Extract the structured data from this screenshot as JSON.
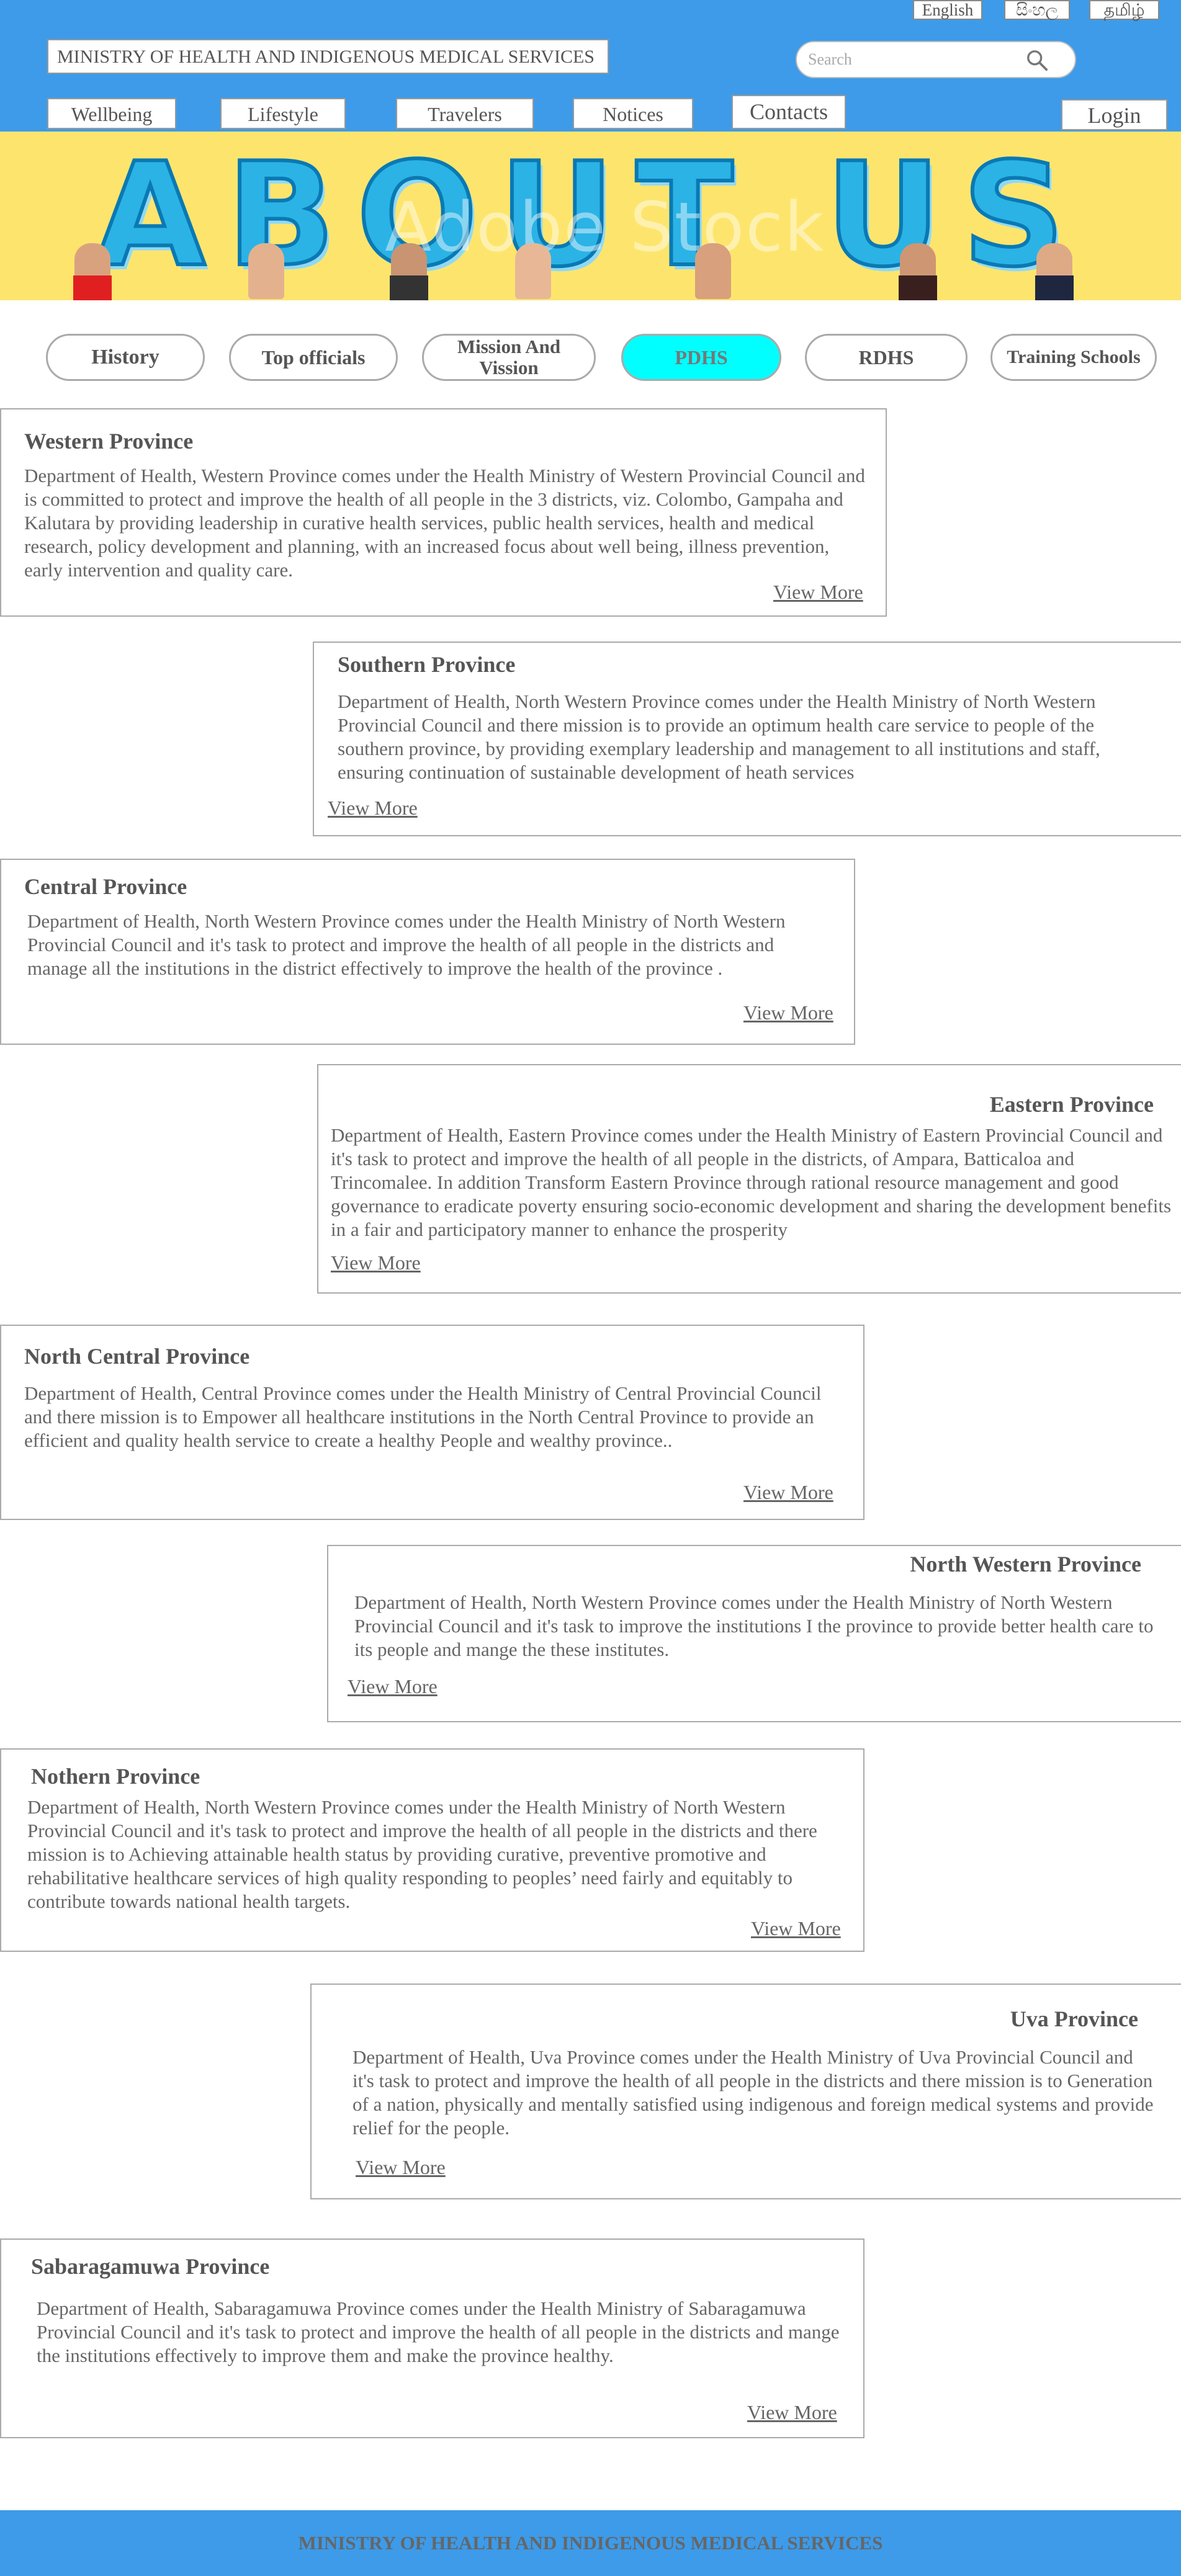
{
  "header": {
    "languages": [
      "English",
      "සිංහල",
      "தமிழ்"
    ],
    "ministry_title": "MINISTRY OF HEALTH AND INDIGENOUS MEDICAL SERVICES",
    "search_placeholder": "Search",
    "nav": [
      "Wellbeing",
      "Lifestyle",
      "Travelers",
      "Notices",
      "Contacts"
    ],
    "login": "Login",
    "colors": {
      "header_bg": "#3d9be9",
      "banner_bg": "#fde56d",
      "active_tab": "#00ffff"
    }
  },
  "banner": {
    "text": "ABOUT US",
    "watermark": "Adobe Stock"
  },
  "tabs": [
    "History",
    "Top officials",
    "Mission And Vission",
    "PDHS",
    "RDHS",
    "Training Schools"
  ],
  "active_tab": "PDHS",
  "provinces": [
    {
      "title": "Western Province",
      "body": "Department of Health, Western Province comes under the Health Ministry of Western Provincial Council and is committed to protect and improve the health of all people in the 3 districts, viz. Colombo, Gampaha and Kalutara by providing leadership in curative health services, public health services, health and medical research, policy development and planning, with an increased focus about well being, illness prevention, early intervention and quality care.",
      "link": "View More"
    },
    {
      "title": "Southern Province",
      "body": "Department of Health, North Western Province comes under the Health Ministry of North Western Provincial Council and there mission is to provide an optimum health care service to people of the southern province, by providing exemplary leadership and  management to all institutions and staff, ensuring continuation of sustainable development of heath services",
      "link": "View More"
    },
    {
      "title": "Central Province",
      "body": "Department of Health, North Western Province comes under the Health Ministry of North Western Provincial Council and it's task to protect and improve the health of all people in the districts and manage all the institutions in the district effectively to improve the health of the province .",
      "link": "View More"
    },
    {
      "title": "Eastern Province",
      "body": "Department of Health, Eastern Province comes under the Health Ministry of Eastern Provincial Council and it's task to protect and improve the health of all people in the districts, of Ampara, Batticaloa and Trincomalee. In addition Transform Eastern Province through rational resource management and good governance to eradicate poverty ensuring socio-economic development and sharing the development benefits in a fair and participatory manner to enhance the prosperity",
      "link": "View More"
    },
    {
      "title": "North Central Province",
      "body": "Department of Health, Central Province comes under the Health Ministry of Central Provincial Council and there mission is to Empower all healthcare institutions in the North Central Province to provide an efficient and quality health service to create a healthy People and wealthy province..",
      "link": "View More"
    },
    {
      "title": "North Western Province",
      "body": "Department of Health, North Western Province comes under the Health Ministry of North Western Provincial Council and it's task to improve the institutions I the province to provide better health care to its people and mange the these institutes.",
      "link": "View More"
    },
    {
      "title": "Nothern Province",
      "body": "Department of Health, North Western Province comes under the Health Ministry of North Western Provincial Council and it's task to protect and improve the health of all people in the districts and there mission is to Achieving attainable health status by providing curative, preventive promotive and rehabilitative healthcare services of high quality responding to peoples’ need fairly and equitably to contribute towards national health targets.",
      "link": "View More"
    },
    {
      "title": "Uva Province",
      "body": "Department of Health, Uva Province comes under the Health Ministry of Uva Provincial Council and it's task to protect and improve the health of all people in the districts and there mission is to Generation of a nation, physically and mentally satisfied using indigenous and foreign medical systems and provide relief for the people.",
      "link": "View More"
    },
    {
      "title": "Sabaragamuwa Province",
      "body": "Department of Health, Sabaragamuwa Province comes under the Health Ministry of Sabaragamuwa Provincial Council and it's task to protect and improve the health of all people in the districts and mange the institutions effectively to improve them and make the province healthy.",
      "link": "View More"
    }
  ],
  "footer": {
    "text": "MINISTRY OF HEALTH AND INDIGENOUS MEDICAL SERVICES"
  }
}
